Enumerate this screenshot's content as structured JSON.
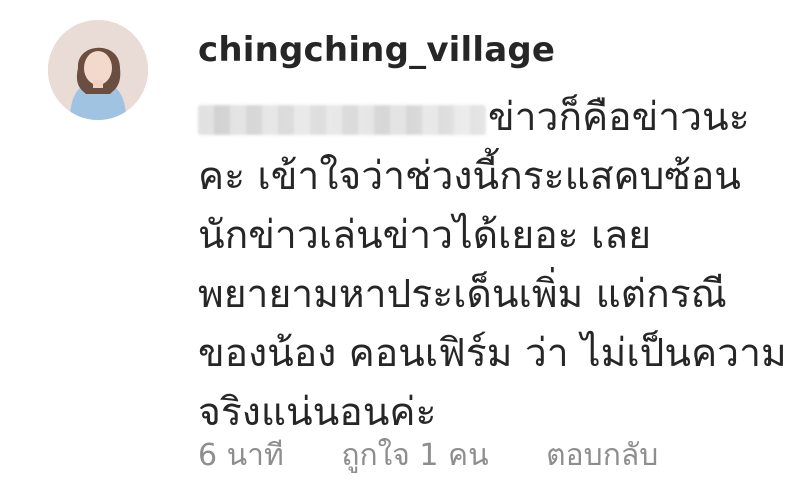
{
  "comment": {
    "username": "chingching_village",
    "avatar_icon": "profile-photo",
    "text_lines": [
      "ข่าวก็คือข่าวนะ",
      "คะ เข้าใจว่าช่วงนี้กระแสคบซ้อน",
      "นักข่าวเล่นข่าวได้เยอะ เลย",
      "พยายามหาประเด็นเพิ่ม แต่กรณี",
      "ของน้อง คอนเฟิร์ม ว่า ไม่เป็นความ",
      "จริงแน่นอนค่ะ"
    ],
    "time": "6 นาที",
    "likes": "ถูกใจ 1 คน",
    "reply": "ตอบกลับ"
  }
}
